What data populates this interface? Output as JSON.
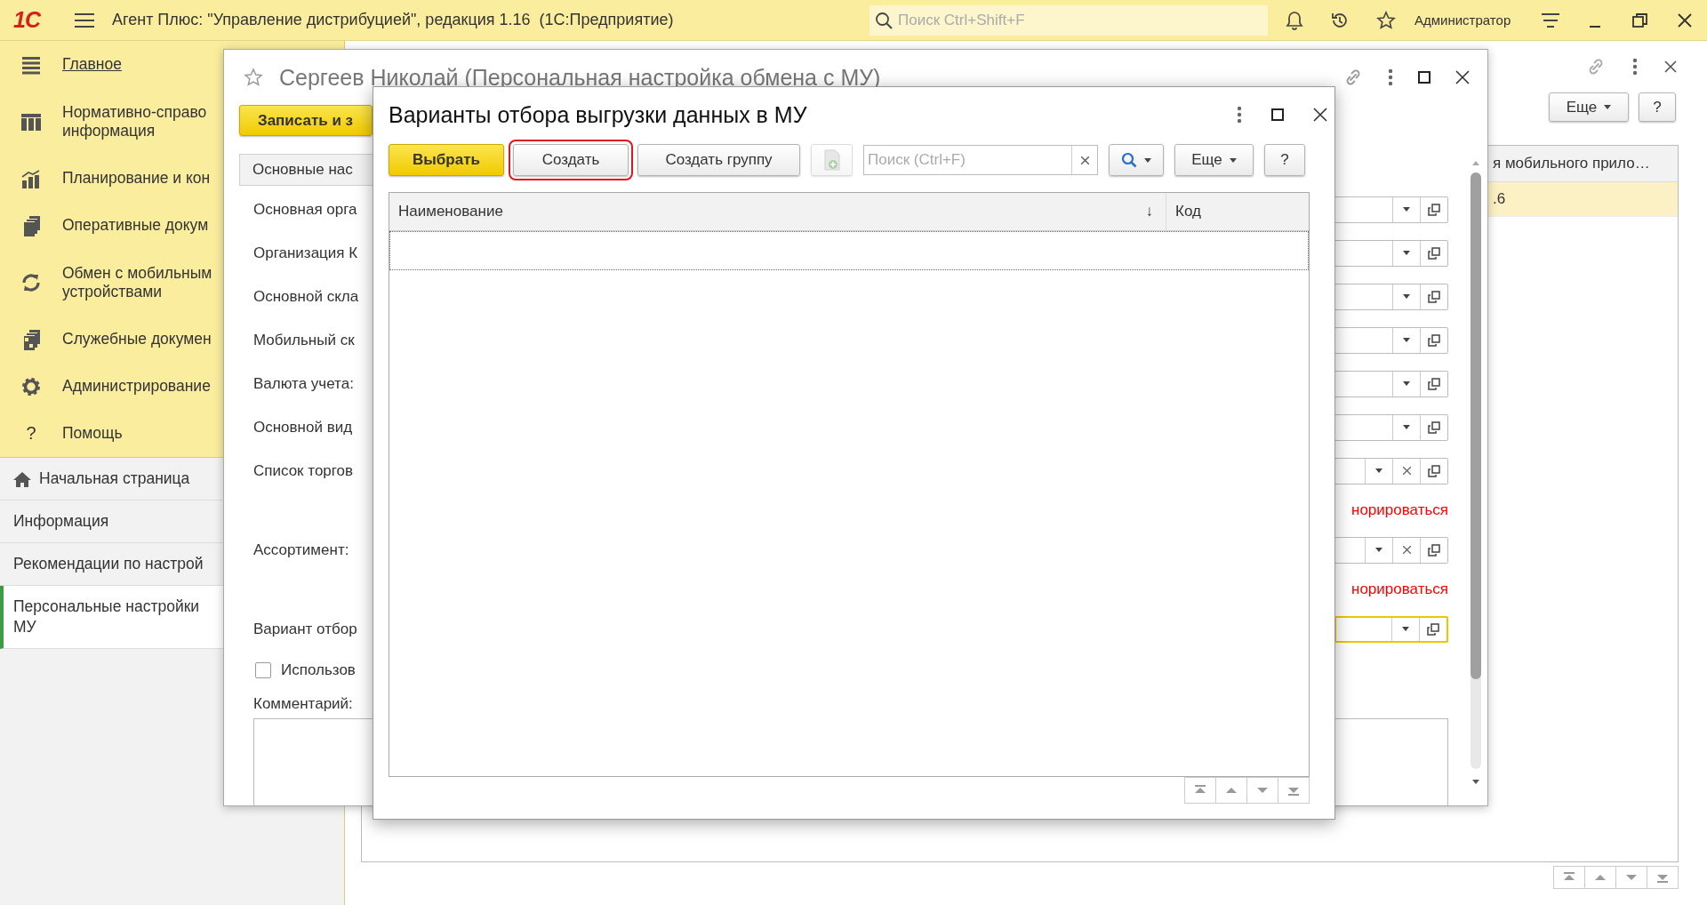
{
  "app_bar": {
    "logo": "1С",
    "title": "Агент Плюс: \"Управление дистрибуцией\", редакция 1.16  (1С:Предприятие)",
    "search": {
      "placeholder": "Поиск Ctrl+Shift+F"
    },
    "user": "Администратор"
  },
  "sections": [
    {
      "lines": [
        "Главное"
      ],
      "selected": true
    },
    {
      "lines": [
        "Нормативно-справо",
        "информация"
      ],
      "selected": false
    },
    {
      "lines": [
        "Планирование и кон"
      ],
      "selected": false
    },
    {
      "lines": [
        "Оперативные докум"
      ],
      "selected": false
    },
    {
      "lines": [
        "Обмен с мобильным",
        "устройствами"
      ],
      "selected": false
    },
    {
      "lines": [
        "Служебные докумен"
      ],
      "selected": false
    },
    {
      "lines": [
        "Администрирование"
      ],
      "selected": false
    },
    {
      "lines": [
        "Помощь"
      ],
      "icon_text": "?",
      "selected": false
    }
  ],
  "open_windows": [
    {
      "lines": [
        "Начальная страница"
      ],
      "selected": false
    },
    {
      "lines": [
        "Информация"
      ],
      "selected": false
    },
    {
      "lines": [
        "Рекомендации по настрой"
      ],
      "selected": false
    },
    {
      "lines": [
        "Персональные настройки",
        "МУ"
      ],
      "selected": true
    }
  ],
  "list_form": {
    "buttons": [
      "Еще",
      "?"
    ],
    "table": {
      "columns": [
        "я мобильного прило…"
      ],
      "rows": [
        {
          "cells": [
            ".6"
          ],
          "selected": true
        }
      ]
    }
  },
  "settings_form": {
    "title": "Сергеев Николай (Персональная настройка обмена с МУ)",
    "save_button": "Записать и з",
    "group_tab": "Основные нас",
    "rows": [
      {
        "kind": "field",
        "label": "Основная орга",
        "clearable": false,
        "focused": false
      },
      {
        "kind": "field",
        "label": "Организация К",
        "clearable": false,
        "focused": false
      },
      {
        "kind": "field",
        "label": "Основной скла",
        "clearable": false,
        "focused": false
      },
      {
        "kind": "field",
        "label": "Мобильный ск",
        "clearable": false,
        "focused": false
      },
      {
        "kind": "field",
        "label": "Валюта учета:",
        "clearable": false,
        "focused": false
      },
      {
        "kind": "field",
        "label": "Основной вид",
        "clearable": false,
        "focused": false
      },
      {
        "kind": "field",
        "label": "Список торгов",
        "clearable": true,
        "focused": false
      },
      {
        "kind": "note",
        "text": "норироваться"
      },
      {
        "kind": "field",
        "label": "Ассортимент:",
        "clearable": true,
        "focused": false
      },
      {
        "kind": "note",
        "text": "норироваться"
      },
      {
        "kind": "field",
        "label": "Вариант отбор",
        "clearable": false,
        "focused": true
      },
      {
        "kind": "checkbox",
        "label": "Использов",
        "checked": false
      },
      {
        "kind": "label",
        "label": "Комментарий:"
      },
      {
        "kind": "textarea"
      }
    ]
  },
  "dialog": {
    "title": "Варианты отбора выгрузки данных в МУ",
    "toolbar": [
      {
        "kind": "primary",
        "label": "Выбрать",
        "highlighted": false
      },
      {
        "kind": "button",
        "label": "Создать",
        "highlighted": true
      },
      {
        "kind": "button",
        "label": "Создать группу",
        "highlighted": false
      },
      {
        "kind": "icon",
        "disabled": true
      },
      {
        "kind": "search",
        "placeholder": "Поиск (Ctrl+F)"
      },
      {
        "kind": "search_button"
      },
      {
        "kind": "menu",
        "label": "Еще"
      },
      {
        "kind": "button",
        "label": "?",
        "highlighted": false
      }
    ],
    "table": {
      "columns": [
        {
          "label": "Наименование",
          "sort": "↓"
        },
        {
          "label": "Код"
        }
      ],
      "rows": [
        {
          "focused": true
        }
      ]
    }
  }
}
